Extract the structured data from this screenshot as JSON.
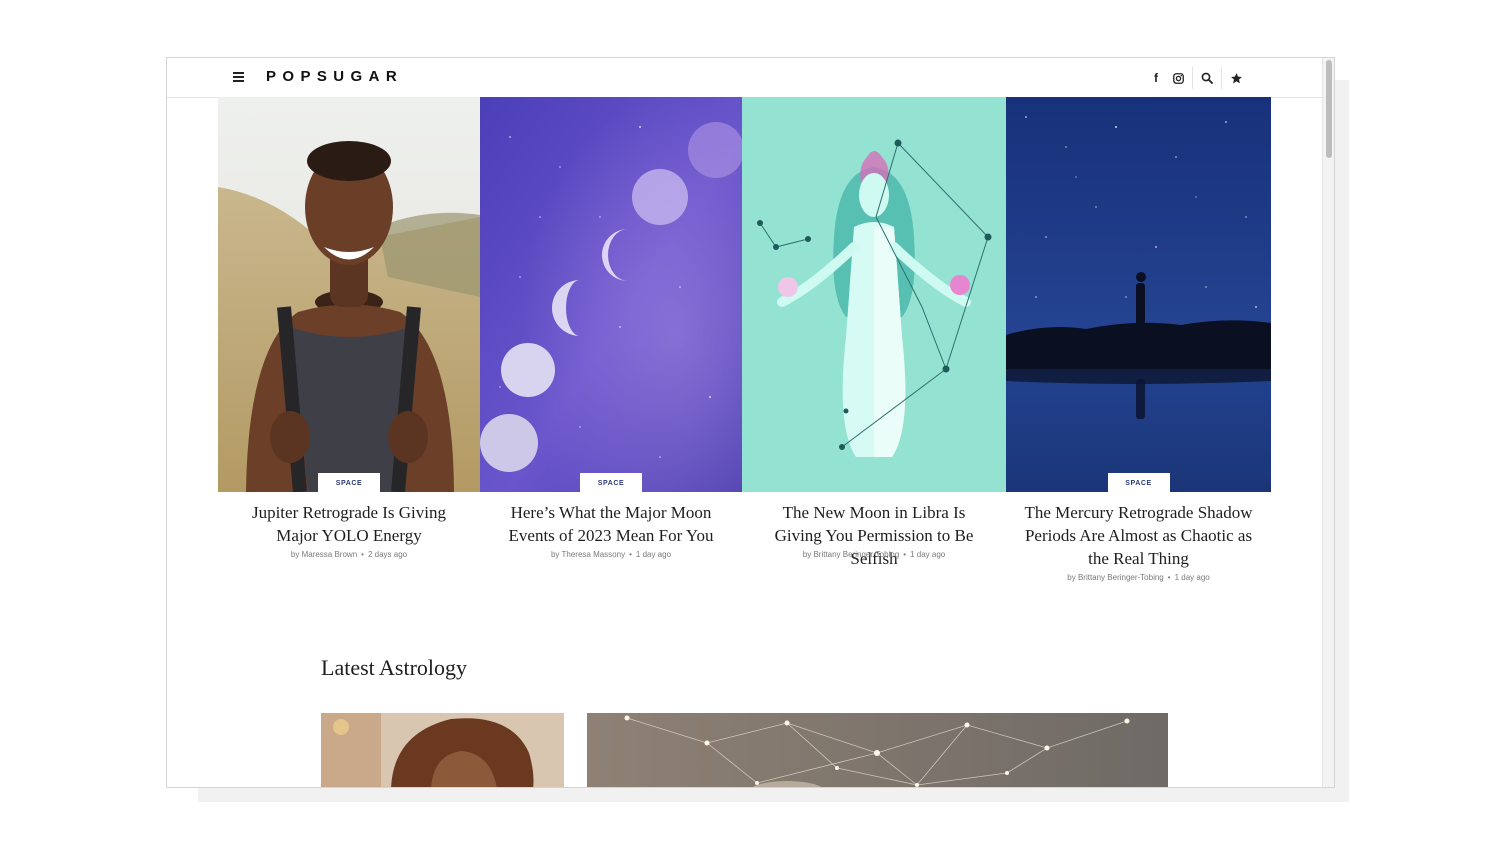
{
  "header": {
    "logo": "POPSUGAR",
    "icons": [
      "hamburger-menu-icon",
      "facebook-icon",
      "instagram-icon",
      "search-icon",
      "star-icon"
    ],
    "facebook_glyph": "f"
  },
  "hero_cards": [
    {
      "category": "SPACE",
      "title": "Jupiter Retrograde Is Giving Major YOLO Energy",
      "author": "by Maressa Brown",
      "date": "2 days ago"
    },
    {
      "category": "SPACE",
      "title": "Here’s What the Major Moon Events of 2023 Mean For You",
      "author": "by Theresa Massony",
      "date": "1 day ago"
    },
    {
      "category": "",
      "title": "The New Moon in Libra Is Giving You Permission to Be Selfish",
      "author": "by Brittany Beringer-Tobing",
      "date": "1 day ago"
    },
    {
      "category": "SPACE",
      "title": "The Mercury Retrograde Shadow Periods Are Almost as Chaotic as the Real Thing",
      "author": "by Brittany Beringer-Tobing",
      "date": "1 day ago"
    }
  ],
  "latest_section": {
    "title": "Latest Astrology"
  },
  "colors": {
    "accent_badge_text": "#2b3a7a",
    "moon_bg": "#5a4fc4",
    "mint_bg": "#94e3d2",
    "night_bg": "#1f3a86"
  }
}
